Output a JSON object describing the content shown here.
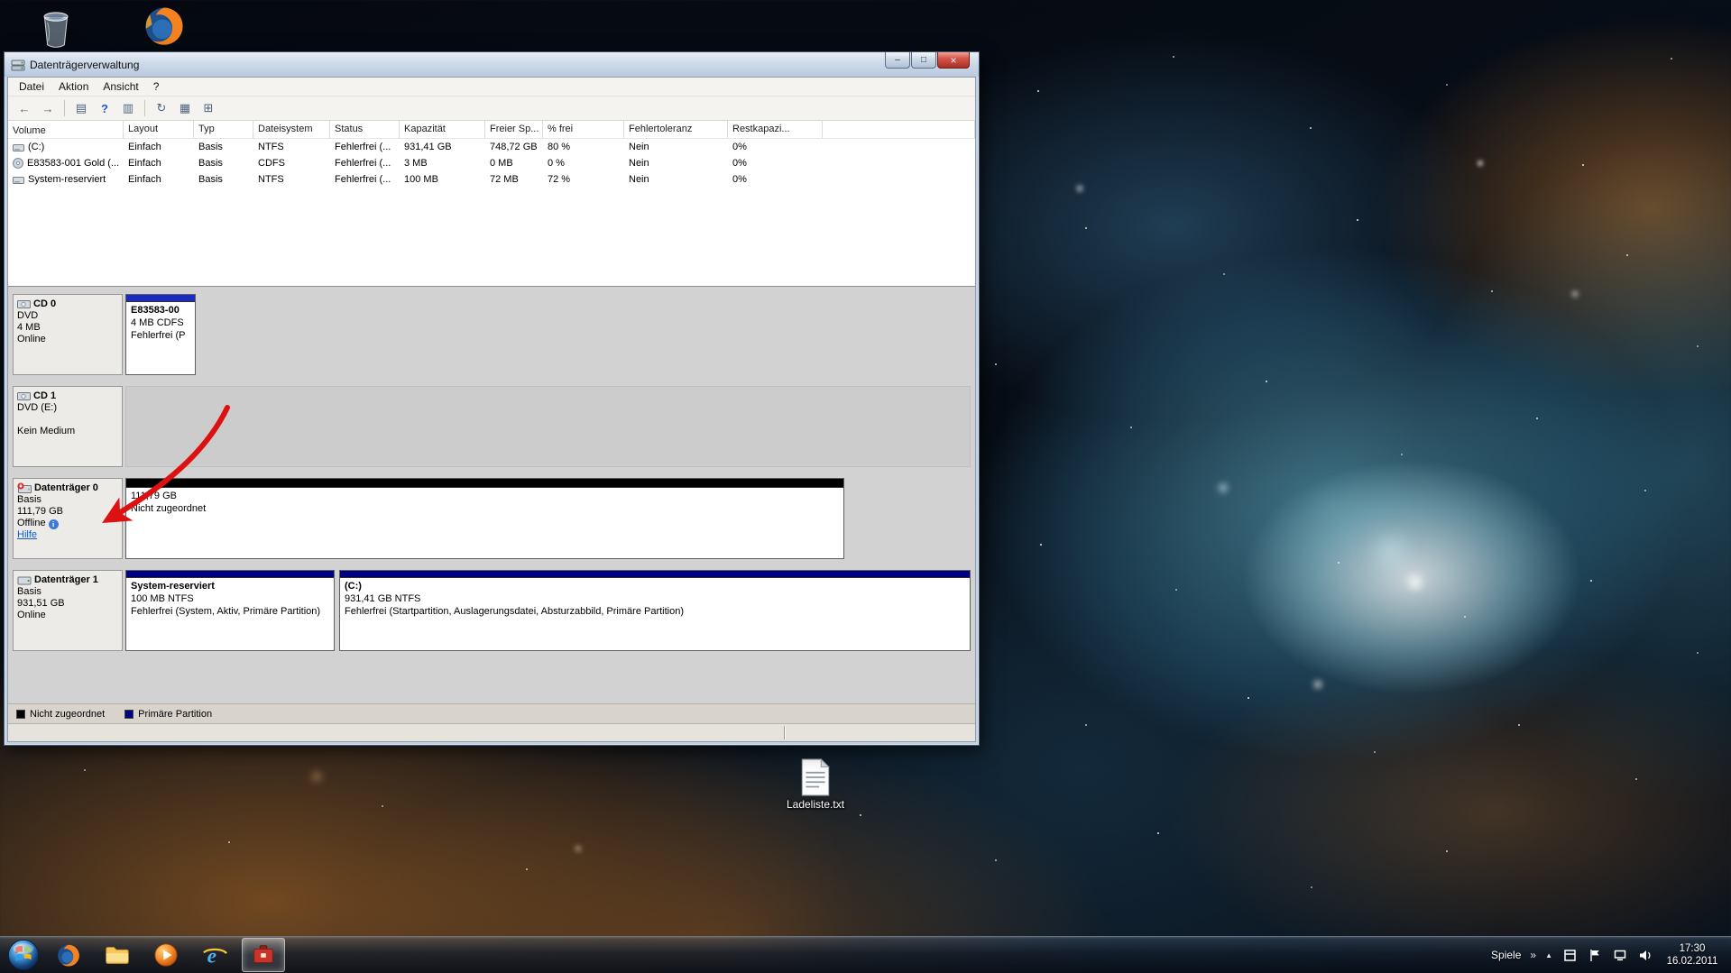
{
  "desktop": {
    "ladeliste_label": "Ladeliste.txt"
  },
  "window": {
    "title": "Datenträgerverwaltung",
    "menu": {
      "datei": "Datei",
      "aktion": "Aktion",
      "ansicht": "Ansicht",
      "hilfe": "?"
    },
    "volume_table": {
      "columns": {
        "volume": "Volume",
        "layout": "Layout",
        "typ": "Typ",
        "dateisystem": "Dateisystem",
        "status": "Status",
        "kapazitaet": "Kapazität",
        "freier_sp": "Freier Sp...",
        "pct_frei": "% frei",
        "fehlertoleranz": "Fehlertoleranz",
        "restkapaz": "Restkapazi..."
      },
      "rows": [
        {
          "volume": "(C:)",
          "layout": "Einfach",
          "typ": "Basis",
          "dateisystem": "NTFS",
          "status": "Fehlerfrei (...",
          "kapazitaet": "931,41 GB",
          "freier_sp": "748,72 GB",
          "pct_frei": "80 %",
          "fehlertoleranz": "Nein",
          "restkapaz": "0%"
        },
        {
          "volume": "E83583-001 Gold (...",
          "layout": "Einfach",
          "typ": "Basis",
          "dateisystem": "CDFS",
          "status": "Fehlerfrei (...",
          "kapazitaet": "3 MB",
          "freier_sp": "0 MB",
          "pct_frei": "0 %",
          "fehlertoleranz": "Nein",
          "restkapaz": "0%"
        },
        {
          "volume": "System-reserviert",
          "layout": "Einfach",
          "typ": "Basis",
          "dateisystem": "NTFS",
          "status": "Fehlerfrei (...",
          "kapazitaet": "100 MB",
          "freier_sp": "72 MB",
          "pct_frei": "72 %",
          "fehlertoleranz": "Nein",
          "restkapaz": "0%"
        }
      ]
    },
    "disks": [
      {
        "name": "CD 0",
        "line1": "DVD",
        "line2": "4 MB",
        "line3": "Online",
        "partition": {
          "title": "E83583-00",
          "size": "4 MB CDFS",
          "status": "Fehlerfrei (P"
        }
      },
      {
        "name": "CD 1",
        "line1": "DVD (E:)",
        "line2": "",
        "line3": "Kein Medium"
      },
      {
        "name": "Datenträger 0",
        "line1": "Basis",
        "line2": "111,79 GB",
        "line3": "Offline",
        "help_link": "Hilfe",
        "partition": {
          "size": "111,79 GB",
          "status": "Nicht zugeordnet"
        }
      },
      {
        "name": "Datenträger 1",
        "line1": "Basis",
        "line2": "931,51 GB",
        "line3": "Online",
        "partition1": {
          "title": "System-reserviert",
          "size": "100 MB NTFS",
          "status": "Fehlerfrei (System, Aktiv, Primäre Partition)"
        },
        "partition2": {
          "title": "(C:)",
          "size": "931,41 GB NTFS",
          "status": "Fehlerfrei (Startpartition, Auslagerungsdatei, Absturzabbild, Primäre Partition)"
        }
      }
    ],
    "legend": {
      "unallocated": "Nicht zugeordnet",
      "primary": "Primäre Partition"
    },
    "colors": {
      "unallocated": "#000000",
      "primary_partition": "#000082",
      "cd_partition": "#1b2bbf",
      "annotation_arrow": "#dd1111"
    }
  },
  "taskbar": {
    "spiele_label": "Spiele",
    "clock": {
      "time": "17:30",
      "date": "16.02.2011"
    }
  }
}
